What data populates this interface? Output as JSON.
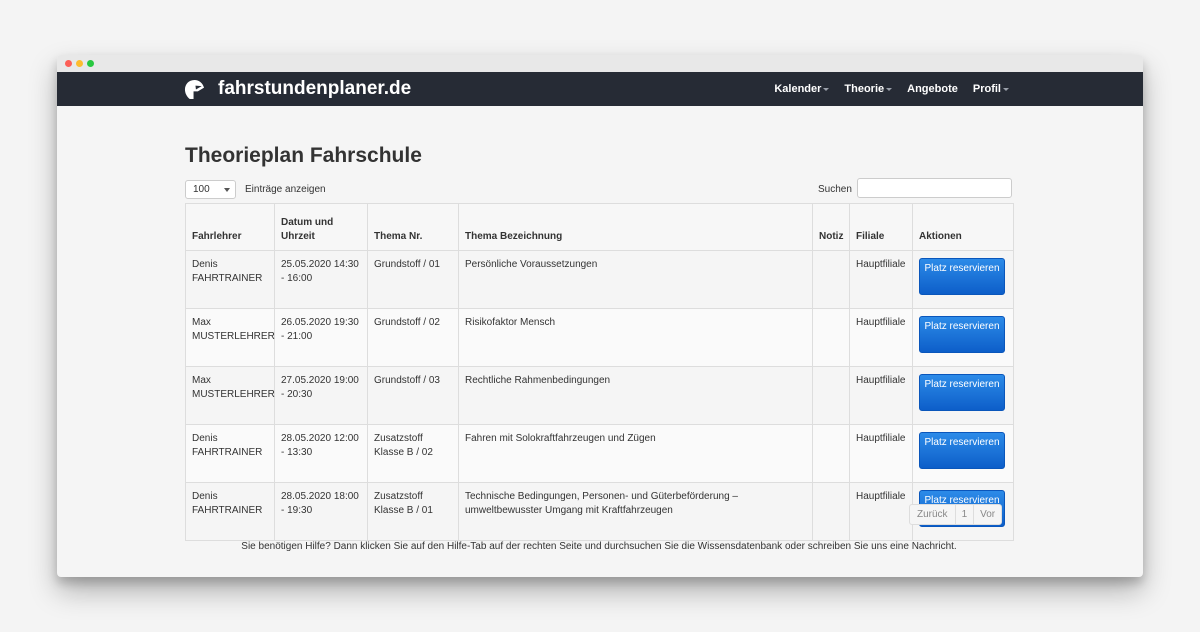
{
  "brand": {
    "name": "fahrstundenplaner.de"
  },
  "nav": {
    "items": [
      {
        "label": "Kalender",
        "dropdown": true
      },
      {
        "label": "Theorie",
        "dropdown": true
      },
      {
        "label": "Angebote",
        "dropdown": false
      },
      {
        "label": "Profil",
        "dropdown": true
      }
    ]
  },
  "page": {
    "title": "Theorieplan Fahrschule"
  },
  "controls": {
    "length_value": "100",
    "length_label": "Einträge anzeigen",
    "search_label": "Suchen",
    "search_value": ""
  },
  "table": {
    "headers": {
      "teacher": "Fahrlehrer",
      "datetime": "Datum und Uhrzeit",
      "topic_no": "Thema Nr.",
      "topic_name": "Thema Bezeichnung",
      "note": "Notiz",
      "branch": "Filiale",
      "actions": "Aktionen"
    },
    "rows": [
      {
        "teacher": "Denis FAHRTRAINER",
        "datetime": "25.05.2020 14:30 - 16:00",
        "topic_no": "Grundstoff / 01",
        "topic_name": "Persönliche Voraussetzungen",
        "note": "",
        "branch": "Hauptfiliale",
        "action": "Platz reservieren"
      },
      {
        "teacher": "Max MUSTERLEHRER",
        "datetime": "26.05.2020 19:30 - 21:00",
        "topic_no": "Grundstoff / 02",
        "topic_name": "Risikofaktor Mensch",
        "note": "",
        "branch": "Hauptfiliale",
        "action": "Platz reservieren"
      },
      {
        "teacher": "Max MUSTERLEHRER",
        "datetime": "27.05.2020 19:00 - 20:30",
        "topic_no": "Grundstoff / 03",
        "topic_name": "Rechtliche Rahmenbedingungen",
        "note": "",
        "branch": "Hauptfiliale",
        "action": "Platz reservieren"
      },
      {
        "teacher": "Denis FAHRTRAINER",
        "datetime": "28.05.2020 12:00 - 13:30",
        "topic_no": "Zusatzstoff Klasse B / 02",
        "topic_name": "Fahren mit Solokraftfahrzeugen und Zügen",
        "note": "",
        "branch": "Hauptfiliale",
        "action": "Platz reservieren"
      },
      {
        "teacher": "Denis FAHRTRAINER",
        "datetime": "28.05.2020 18:00 - 19:30",
        "topic_no": "Zusatzstoff Klasse B / 01",
        "topic_name": "Technische Bedingungen, Personen- und Güterbeförderung – umweltbewusster Umgang mit Kraftfahrzeugen",
        "note": "",
        "branch": "Hauptfiliale",
        "action": "Platz reservieren"
      }
    ]
  },
  "pagination": {
    "prev": "Zurück",
    "page": "1",
    "next": "Vor"
  },
  "help_text": "Sie benötigen Hilfe? Dann klicken Sie auf den Hilfe-Tab auf der rechten Seite und durchsuchen Sie die Wissensdatenbank oder schreiben Sie uns eine Nachricht.",
  "colors": {
    "navbar": "#262b35",
    "button": "#1a73d9"
  }
}
